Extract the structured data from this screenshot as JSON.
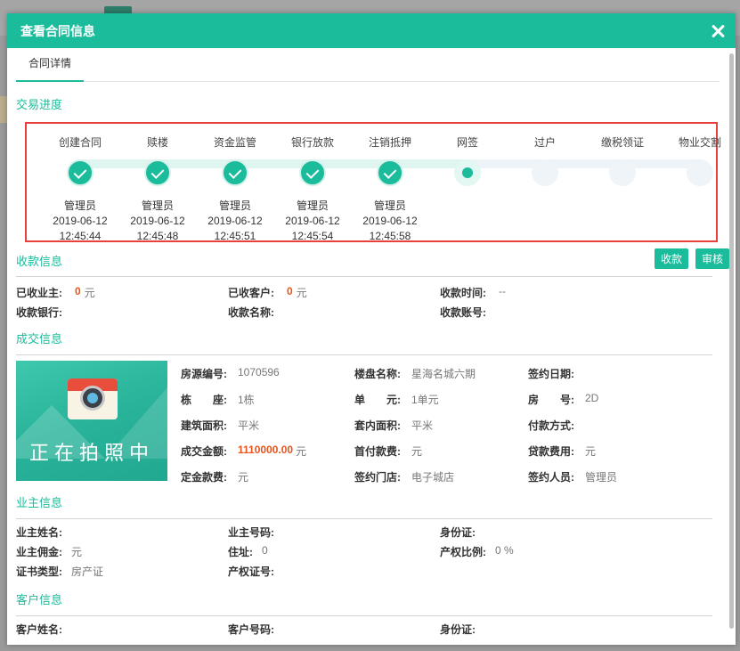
{
  "modal": {
    "title": "查看合同信息"
  },
  "tabs": [
    {
      "label": "合同详情"
    }
  ],
  "progress": {
    "title": "交易进度",
    "steps": [
      {
        "label": "创建合同",
        "user": "管理员",
        "date": "2019-06-12",
        "time": "12:45:44",
        "state": "done"
      },
      {
        "label": "赎楼",
        "user": "管理员",
        "date": "2019-06-12",
        "time": "12:45:48",
        "state": "done"
      },
      {
        "label": "资金监管",
        "user": "管理员",
        "date": "2019-06-12",
        "time": "12:45:51",
        "state": "done"
      },
      {
        "label": "银行放款",
        "user": "管理员",
        "date": "2019-06-12",
        "time": "12:45:54",
        "state": "done"
      },
      {
        "label": "注销抵押",
        "user": "管理员",
        "date": "2019-06-12",
        "time": "12:45:58",
        "state": "done"
      },
      {
        "label": "网签",
        "user": "",
        "date": "",
        "time": "",
        "state": "current"
      },
      {
        "label": "过户",
        "user": "",
        "date": "",
        "time": "",
        "state": "pending"
      },
      {
        "label": "缴税领证",
        "user": "",
        "date": "",
        "time": "",
        "state": "pending"
      },
      {
        "label": "物业交割",
        "user": "",
        "date": "",
        "time": "",
        "state": "pending"
      }
    ]
  },
  "payment": {
    "title": "收款信息",
    "collect_label": "收款",
    "audit_label": "审核",
    "owner_received_k": "已收业主:",
    "owner_received_v": "0",
    "owner_received_unit": "元",
    "client_received_k": "已收客户:",
    "client_received_v": "0",
    "client_received_unit": "元",
    "time_k": "收款时间:",
    "time_v": "--",
    "bank_k": "收款银行:",
    "name_k": "收款名称:",
    "account_k": "收款账号:"
  },
  "deal": {
    "title": "成交信息",
    "image_caption": "正在拍照中",
    "rows": [
      [
        {
          "k": "房源编号:",
          "v": "1070596"
        },
        {
          "k": "楼盘名称:",
          "v": "星海名城六期"
        },
        {
          "k": "签约日期:",
          "v": ""
        }
      ],
      [
        {
          "k": "栋　　座:",
          "v": "1栋"
        },
        {
          "k": "单　　元:",
          "v": "1单元"
        },
        {
          "k": "房　　号:",
          "v": "2D"
        }
      ],
      [
        {
          "k": "建筑面积:",
          "v": "平米"
        },
        {
          "k": "套内面积:",
          "v": "平米"
        },
        {
          "k": "付款方式:",
          "v": ""
        }
      ],
      [
        {
          "k": "成交金额:",
          "v": "1110000.00",
          "unit": "元"
        },
        {
          "k": "首付款费:",
          "v": "元"
        },
        {
          "k": "贷款费用:",
          "v": "元"
        }
      ],
      [
        {
          "k": "定金款费:",
          "v": "元"
        },
        {
          "k": "签约门店:",
          "v": "电子城店"
        },
        {
          "k": "签约人员:",
          "v": "管理员"
        }
      ]
    ]
  },
  "owner": {
    "title": "业主信息",
    "rows": [
      [
        {
          "k": "业主姓名:",
          "v": ""
        },
        {
          "k": "业主号码:",
          "v": ""
        },
        {
          "k": "身份证:",
          "v": ""
        }
      ],
      [
        {
          "k": "业主佣金:",
          "v": "元"
        },
        {
          "k": "住址:",
          "v": "0"
        },
        {
          "k": "产权比例:",
          "v": "0 %"
        }
      ],
      [
        {
          "k": "证书类型:",
          "v": "房产证"
        },
        {
          "k": "产权证号:",
          "v": ""
        },
        {
          "k": "",
          "v": ""
        }
      ]
    ]
  },
  "client": {
    "title": "客户信息",
    "rows": [
      [
        {
          "k": "客户姓名:",
          "v": ""
        },
        {
          "k": "客户号码:",
          "v": ""
        },
        {
          "k": "身份证:",
          "v": ""
        }
      ]
    ]
  },
  "colors": {
    "accent": "#1bbc9b",
    "highlight_border": "#e8403c",
    "amount": "#e8541d"
  }
}
